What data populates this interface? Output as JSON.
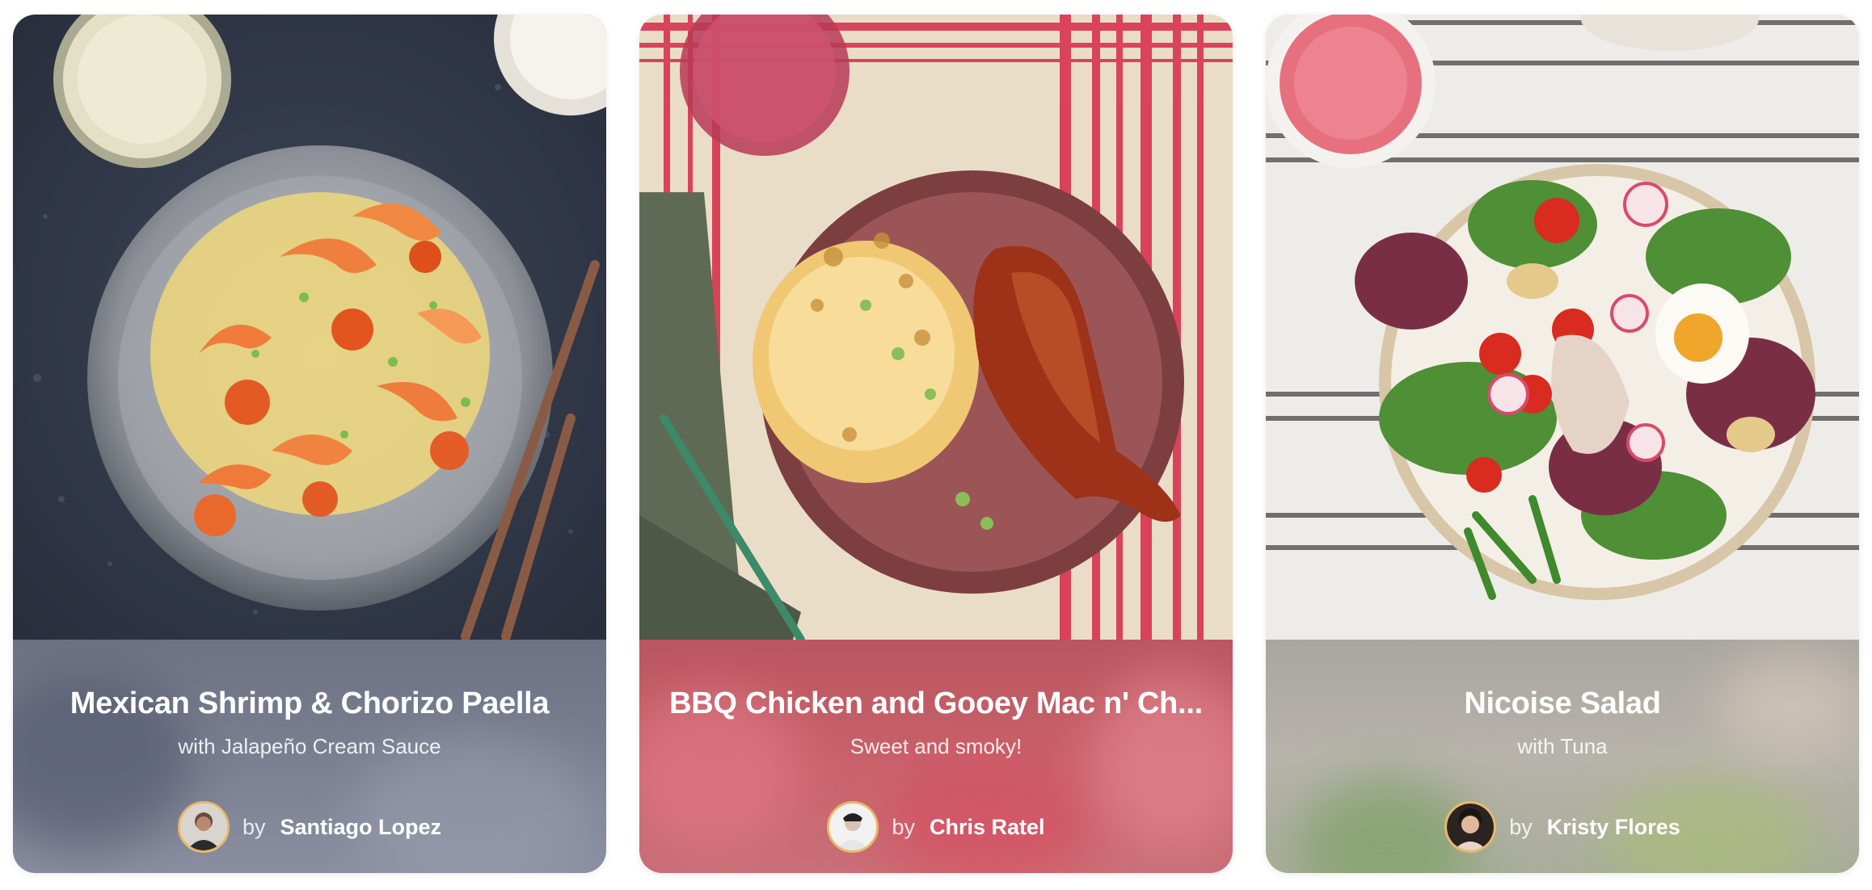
{
  "recipes": [
    {
      "title": "Mexican Shrimp & Chorizo Paella",
      "subtitle": "with Jalapeño Cream Sauce",
      "by_label": "by",
      "author": "Santiago Lopez",
      "accent": "#7b8092"
    },
    {
      "title": "BBQ Chicken and Gooey Mac n' Ch...",
      "subtitle": "Sweet and smoky!",
      "by_label": "by",
      "author": "Chris Ratel",
      "accent": "#c8616a"
    },
    {
      "title": "Nicoise Salad",
      "subtitle": "with Tuna",
      "by_label": "by",
      "author": "Kristy Flores",
      "accent": "#b7b3ab"
    }
  ]
}
